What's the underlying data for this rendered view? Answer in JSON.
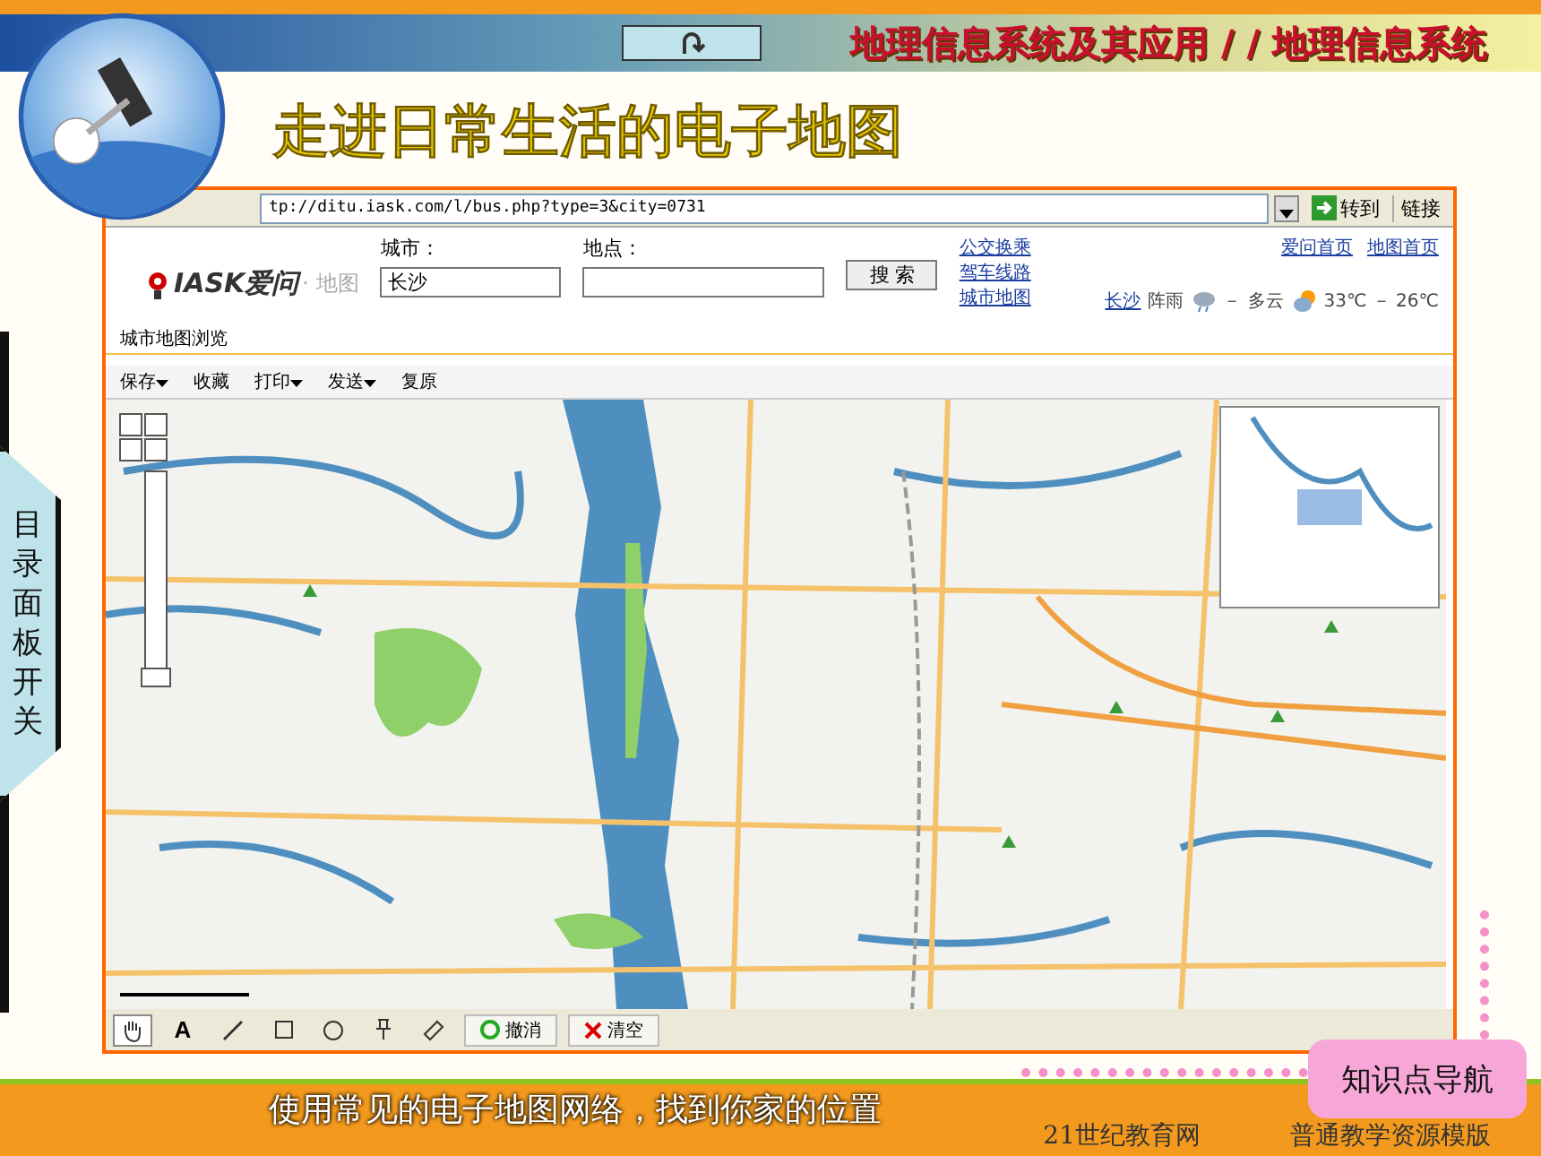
{
  "header": {
    "title": "地理信息系统及其应用 / / 地理信息系统"
  },
  "slide_title": "走进日常生活的电子地图",
  "side_tab": "目录面板开关",
  "browser": {
    "address": "tp://ditu.iask.com/l/bus.php?type=3&city=0731",
    "go_button": "转到",
    "links_button": "链接",
    "logo": "IASK爱问",
    "logo_sub": "· 地图",
    "city_label": "城市：",
    "city_value": "长沙",
    "place_label": "地点：",
    "search_button": "搜 索",
    "links": [
      "公交换乘",
      "驾车线路",
      "城市地图"
    ],
    "top_links": [
      "爱问首页",
      "地图首页"
    ],
    "weather": {
      "city": "长沙",
      "today": "阵雨",
      "dash": "－",
      "tomorrow": "多云",
      "temps": "33℃ －  26℃"
    },
    "breadcrumb": "城市地图浏览",
    "toolbar": [
      {
        "label": "保存",
        "dropdown": true
      },
      {
        "label": "收藏",
        "dropdown": false
      },
      {
        "label": "打印",
        "dropdown": true
      },
      {
        "label": "发送",
        "dropdown": true
      },
      {
        "label": "复原",
        "dropdown": false
      }
    ],
    "tools": [
      {
        "kind": "hand",
        "selected": true
      },
      {
        "kind": "text",
        "label": "A",
        "selected": false
      },
      {
        "kind": "line",
        "selected": false
      },
      {
        "kind": "rect",
        "selected": false
      },
      {
        "kind": "circle",
        "selected": false
      },
      {
        "kind": "pin",
        "selected": false
      },
      {
        "kind": "ruler",
        "selected": false
      }
    ],
    "undo_button": "撤消",
    "clear_button": "清空"
  },
  "nav_button": "知识点导航",
  "caption": "使用常见的电子地图网络，找到你家的位置",
  "footer": {
    "site": "21世纪教育网",
    "template": "普通教学资源模版"
  }
}
